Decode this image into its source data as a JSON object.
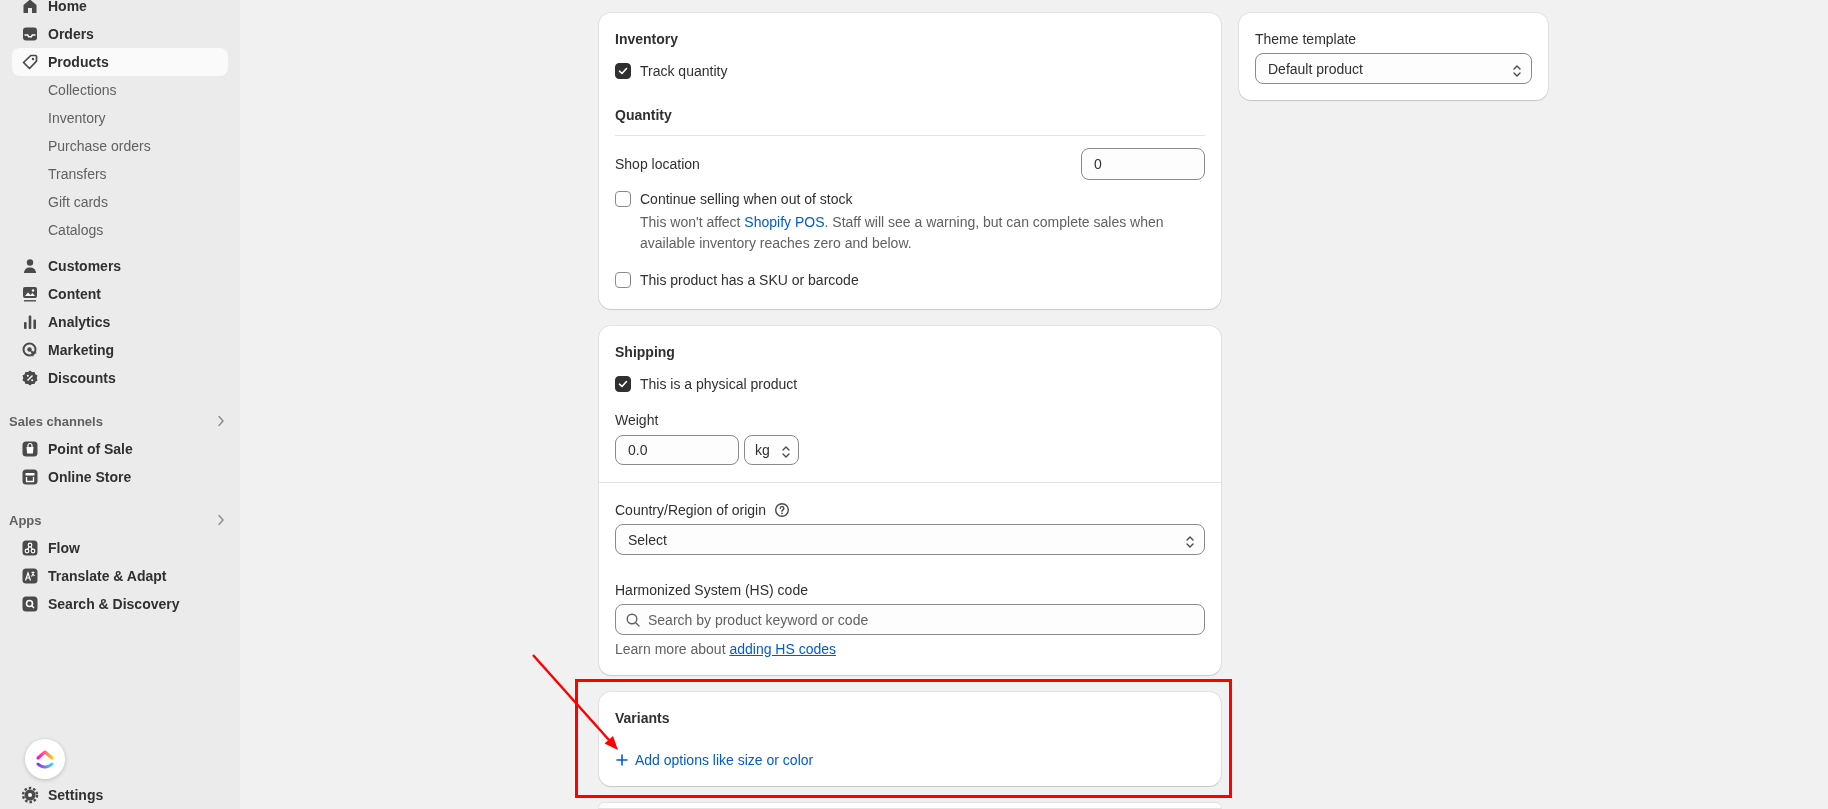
{
  "sidebar": {
    "items": [
      {
        "label": "Home",
        "selected": false
      },
      {
        "label": "Orders",
        "selected": false
      },
      {
        "label": "Products",
        "selected": true,
        "children": [
          {
            "label": "Collections",
            "selected": false
          },
          {
            "label": "Inventory",
            "selected": false
          },
          {
            "label": "Purchase orders",
            "selected": false
          },
          {
            "label": "Transfers",
            "selected": false
          },
          {
            "label": "Gift cards",
            "selected": false
          },
          {
            "label": "Catalogs",
            "selected": false
          }
        ]
      },
      {
        "label": "Customers",
        "selected": false
      },
      {
        "label": "Content",
        "selected": false
      },
      {
        "label": "Analytics",
        "selected": false
      },
      {
        "label": "Marketing",
        "selected": false
      },
      {
        "label": "Discounts",
        "selected": false
      }
    ],
    "sections": [
      {
        "title": "Sales channels",
        "items": [
          {
            "label": "Point of Sale",
            "selected": false
          },
          {
            "label": "Online Store",
            "selected": false
          }
        ]
      },
      {
        "title": "Apps",
        "items": [
          {
            "label": "Flow",
            "selected": false
          },
          {
            "label": "Translate & Adapt",
            "selected": false
          },
          {
            "label": "Search & Discovery",
            "selected": false
          }
        ]
      }
    ],
    "settings": {
      "label": "Settings"
    }
  },
  "inventory": {
    "title": "Inventory",
    "track_quantity": {
      "label": "Track quantity",
      "checked": true
    },
    "quantity_title": "Quantity",
    "location": {
      "label": "Shop location",
      "value": "0"
    },
    "continue_selling": {
      "label": "Continue selling when out of stock",
      "checked": false,
      "help_before": "This won't affect ",
      "help_link": "Shopify POS",
      "help_after": ". Staff will see a warning, but can complete sales when available inventory reaches zero and below."
    },
    "sku": {
      "label": "This product has a SKU or barcode",
      "checked": false
    }
  },
  "shipping": {
    "title": "Shipping",
    "physical": {
      "label": "This is a physical product",
      "checked": true
    },
    "weight": {
      "label": "Weight",
      "value": "0.0",
      "unit": "kg"
    },
    "origin": {
      "label": "Country/Region of origin",
      "value": "Select"
    },
    "hs_code": {
      "label": "Harmonized System (HS) code",
      "placeholder": "Search by product keyword or code"
    },
    "learn_more": {
      "text": "Learn more about ",
      "link": "adding HS codes"
    }
  },
  "variants": {
    "title": "Variants",
    "add_button": "Add options like size or color"
  },
  "theme_template": {
    "label": "Theme template",
    "value": "Default product"
  }
}
